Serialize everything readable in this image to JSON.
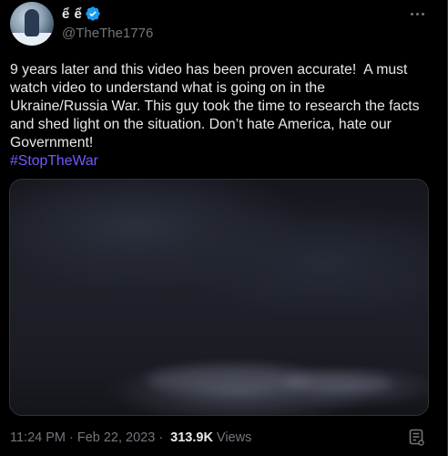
{
  "author": {
    "display_name": "ể ể",
    "handle": "@TheThe1776",
    "verified": true,
    "avatar_icon": "avatar-photo"
  },
  "tweet": {
    "text": "9 years later and this video has been proven accurate!  A must watch video to understand what is going on in the Ukraine/Russia War. This guy took the time to research the facts and shed light on the situation. Don’t hate America, hate our Government!",
    "hashtag": "#StopTheWar",
    "time": "11:24 PM",
    "date": "Feb 22, 2023",
    "views_count": "313.9K",
    "views_label": "Views"
  },
  "icons": {
    "more": "more-options-icon",
    "verified": "verified-badge-icon",
    "analytics": "analytics-icon"
  },
  "colors": {
    "background": "#000000",
    "text": "#e7e9ea",
    "secondary_text": "#71767b",
    "hashtag": "#7856ff",
    "verified": "#1d9bf0"
  }
}
